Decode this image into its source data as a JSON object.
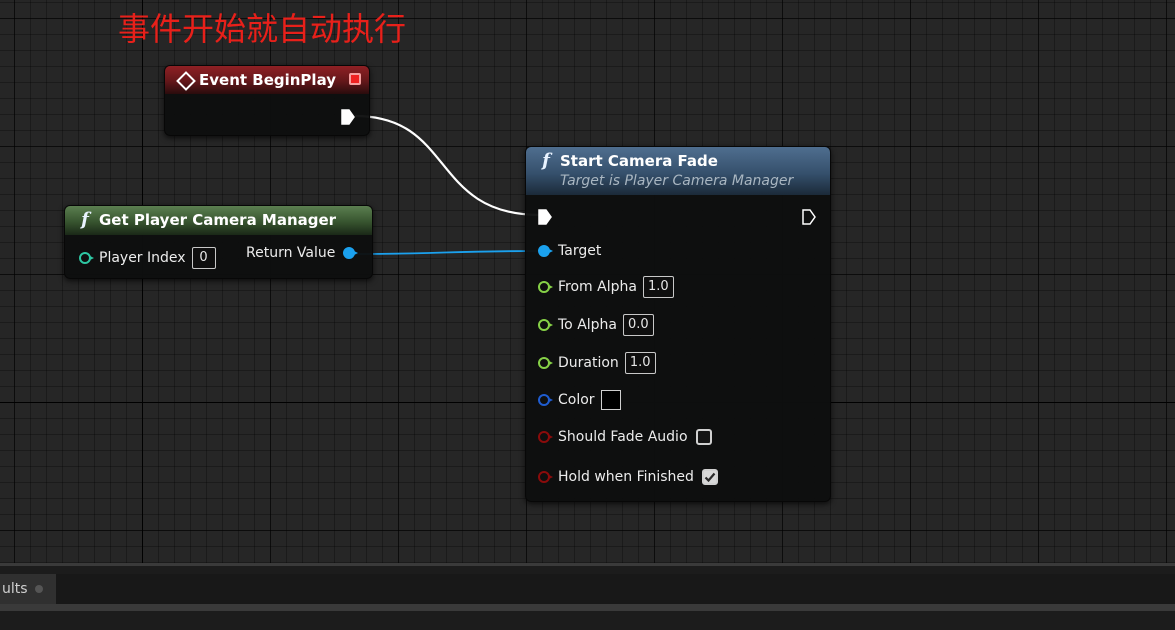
{
  "annotation": {
    "text": "事件开始就自动执行",
    "color": "#e8201a"
  },
  "nodes": {
    "event_begin_play": {
      "title": "Event BeginPlay",
      "header_color": "#8f2024",
      "icon": "event-diamond-icon"
    },
    "get_player_camera_manager": {
      "title": "Get Player Camera Manager",
      "header_color": "#5b7f50",
      "icon": "function-icon",
      "icon_glyph": "f",
      "inputs": [
        {
          "label": "Player Index",
          "value": "0"
        }
      ],
      "outputs": [
        {
          "label": "Return Value"
        }
      ]
    },
    "start_camera_fade": {
      "title": "Start Camera Fade",
      "subtitle": "Target is Player Camera Manager",
      "header_color": "#4f6e8f",
      "icon": "function-icon",
      "icon_glyph": "f",
      "pins": {
        "target": {
          "label": "Target"
        },
        "from_alpha": {
          "label": "From Alpha",
          "value": "1.0"
        },
        "to_alpha": {
          "label": "To Alpha",
          "value": "0.0"
        },
        "duration": {
          "label": "Duration",
          "value": "1.0"
        },
        "color": {
          "label": "Color",
          "value": "#000000"
        },
        "should_fade_audio": {
          "label": "Should Fade Audio",
          "checked": false
        },
        "hold_when_finished": {
          "label": "Hold when Finished",
          "checked": true
        }
      }
    }
  },
  "pin_colors": {
    "exec": "#ffffff",
    "object": "#1ba1ee",
    "float": "#86d147",
    "integer": "#2ec7a3",
    "struct": "#1f5ccf",
    "bool": "#8a0b0b"
  },
  "bottom_panel": {
    "tab_label": "ults"
  }
}
